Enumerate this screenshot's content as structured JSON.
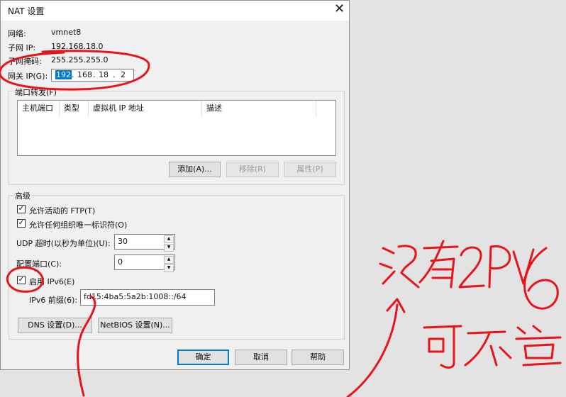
{
  "window": {
    "title": "NAT 设置"
  },
  "info": {
    "network_label": "网络:",
    "network_value": "vmnet8",
    "subnet_ip_label": "子网 IP:",
    "subnet_ip_value": "192.168.18.0",
    "subnet_mask_label": "子网掩码:",
    "subnet_mask_value": "255.255.255.0",
    "gateway_label": "网关 IP(G):",
    "gateway_octets": [
      "192",
      "168",
      "18",
      "2"
    ]
  },
  "port_forwarding": {
    "group_label": "端口转发(F)",
    "columns": [
      "主机端口",
      "类型",
      "虚拟机 IP 地址",
      "描述"
    ],
    "add_label": "添加(A)...",
    "remove_label": "移除(R)",
    "properties_label": "属性(P)"
  },
  "advanced": {
    "group_label": "高级",
    "allow_active_ftp": {
      "label": "允许活动的 FTP(T)",
      "checked": true
    },
    "allow_any_oui": {
      "label": "允许任何组织唯一标识符(O)",
      "checked": true
    },
    "udp_timeout_label": "UDP 超时(以秒为单位)(U):",
    "udp_timeout_value": "30",
    "config_port_label": "配置端口(C):",
    "config_port_value": "0",
    "enable_ipv6": {
      "label": "启用 IPv6(E)",
      "checked": true
    },
    "ipv6_prefix_label": "IPv6 前缀(6):",
    "ipv6_prefix_value": "fd15:4ba5:5a2b:1008::/64",
    "dns_label": "DNS 设置(D)...",
    "netbios_label": "NetBIOS 设置(N)..."
  },
  "footer": {
    "ok_label": "确定",
    "cancel_label": "取消",
    "help_label": "帮助"
  },
  "annotation": {
    "color": "#e8141a"
  }
}
